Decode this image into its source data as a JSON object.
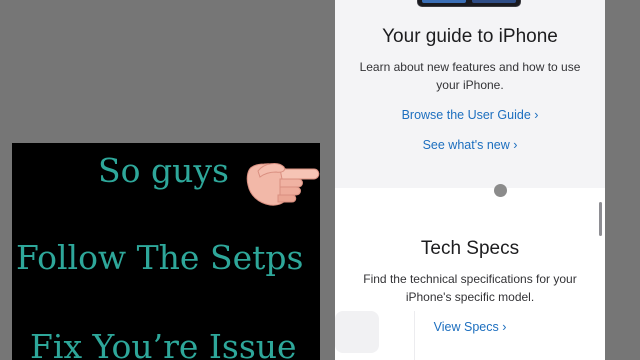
{
  "overlay": {
    "line1": "So guys",
    "line2": "Follow The Setps",
    "line3": "Fix You’re Issue",
    "hand_icon": "pointing-right-hand-icon",
    "text_color": "#2ea79a",
    "background": "#000000"
  },
  "guide": {
    "title": "Your guide to iPhone",
    "description": "Learn about new features and how to use your iPhone.",
    "browse_link": "Browse the User Guide ›",
    "new_link": "See what's new ›"
  },
  "specs": {
    "title": "Tech Specs",
    "description": "Find the technical specifications for your iPhone's specific model.",
    "view_link": "View Specs ›"
  },
  "colors": {
    "link": "#1d6fbf",
    "page_background": "#767676",
    "guide_background": "#f4f4f6"
  }
}
